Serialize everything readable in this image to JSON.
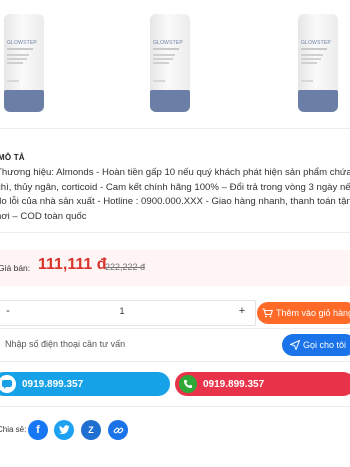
{
  "products": {
    "brand_text": "GLOWSTEP",
    "images": [
      "product-tube",
      "product-tube",
      "product-tube"
    ]
  },
  "description": {
    "heading": "MÔ TẢ",
    "text": "Thương hiệu: Almonds - Hoàn tiền gấp 10 nếu quý khách phát hiện sản phẩm chứa chì, thủy ngân, corticoid - Cam kết chính hãng 100% – Đổi trả trong vòng 3 ngày nếu do lỗi của nhà sản xuất - Hotline : 0900.000.XXX - Giao hàng nhanh, thanh toán tận nơi – COD toàn quốc"
  },
  "price": {
    "label": "Giá bán:",
    "current": "111,111 đ",
    "original": "222,222 đ",
    "accent_color": "#d9342b"
  },
  "quantity": {
    "minus": "-",
    "value": "1",
    "plus": "+"
  },
  "actions": {
    "add_to_cart": "Thêm vào giỏ hàng",
    "phone_placeholder": "Nhập số điện thoại cần tư vấn",
    "call_me": "Gọi cho tôi"
  },
  "hotlines": [
    {
      "number": "0919.899.357",
      "color": "#17a2e8",
      "icon": "zalo-icon"
    },
    {
      "number": "0919.899.357",
      "color": "#e8334a",
      "icon": "phone-icon"
    }
  ],
  "share": {
    "label": "Chia sẻ:",
    "networks": [
      {
        "name": "facebook",
        "glyph": "f",
        "color": "#1877f2"
      },
      {
        "name": "twitter",
        "glyph": "t",
        "color": "#1da1f2"
      },
      {
        "name": "zalo",
        "glyph": "Z",
        "color": "#1f6fd1"
      },
      {
        "name": "copy-link",
        "glyph": "🔗",
        "color": "#1a73e8"
      }
    ]
  }
}
